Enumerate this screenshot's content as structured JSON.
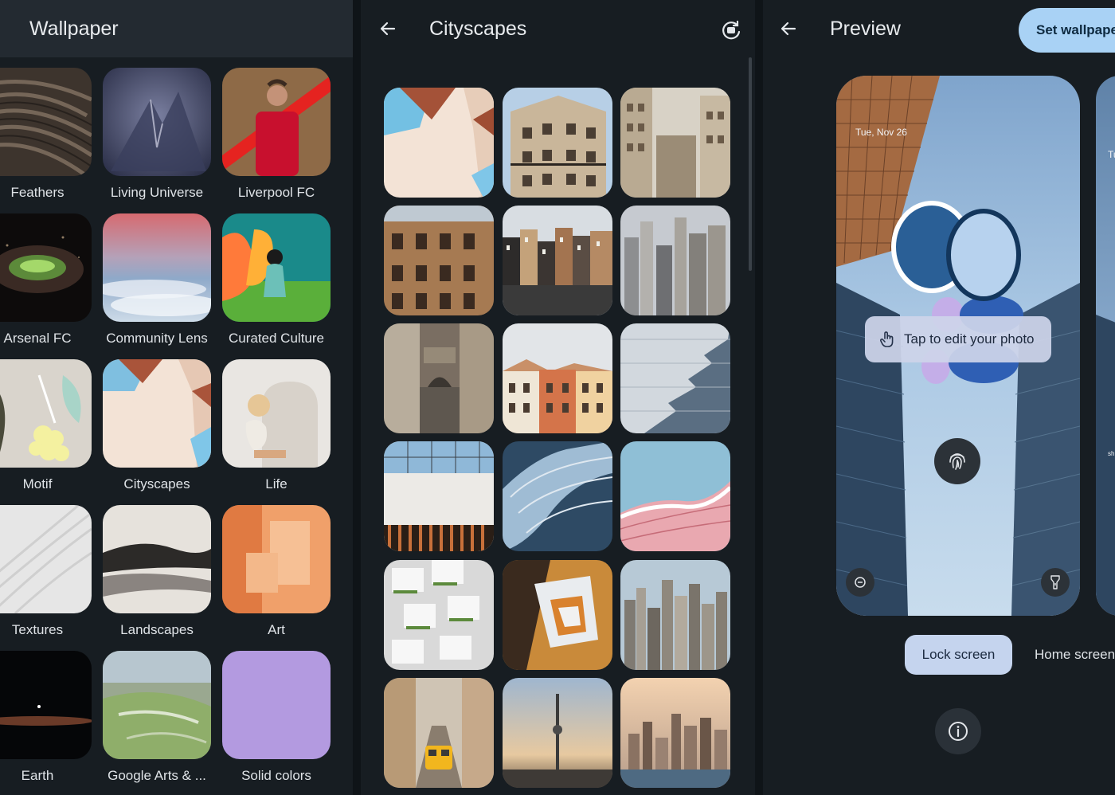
{
  "panel_left": {
    "title": "Wallpaper",
    "categories": [
      {
        "label": "Feathers"
      },
      {
        "label": "Living Universe"
      },
      {
        "label": "Liverpool FC"
      },
      {
        "label": "Arsenal FC"
      },
      {
        "label": "Community Lens"
      },
      {
        "label": "Curated Culture"
      },
      {
        "label": "Motif"
      },
      {
        "label": "Cityscapes"
      },
      {
        "label": "Life"
      },
      {
        "label": "Textures"
      },
      {
        "label": "Landscapes"
      },
      {
        "label": "Art"
      },
      {
        "label": "Earth"
      },
      {
        "label": "Google Arts & ..."
      },
      {
        "label": "Solid colors"
      }
    ]
  },
  "panel_middle": {
    "title": "Cityscapes",
    "back_icon": "arrow-left-icon",
    "action_icon": "rotate-camera-icon"
  },
  "panel_right": {
    "title": "Preview",
    "back_icon": "arrow-left-icon",
    "set_button": "Set wallpape",
    "date": "Tue, Nov 26",
    "second_date": "Tu",
    "clock_hour": "09",
    "edit_hint": "Tap to edit your photo",
    "tabs": {
      "lock": "Lock screen",
      "home": "Home screen"
    },
    "second_preview_hint": "sh",
    "info_icon": "info-icon"
  },
  "colors": {
    "accent": "#a9d2f5",
    "panel_bg": "#171d22",
    "background": "#0f1418",
    "selected_tab": "#c5d4ee"
  }
}
